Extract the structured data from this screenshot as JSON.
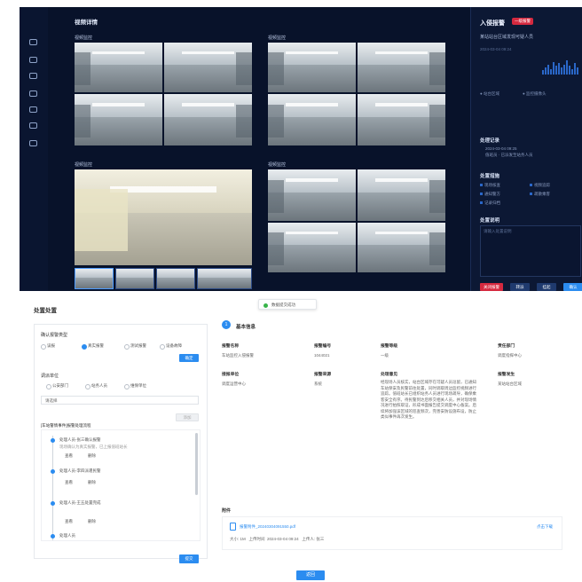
{
  "video_panel": {
    "title": "视频详情",
    "group_labels": [
      "视频监控",
      "视频监控",
      "视频监控",
      "视频监控"
    ]
  },
  "alarm": {
    "title": "入侵报警",
    "badge": "一级报警",
    "subtitle": "某站站台区域发现可疑人员",
    "date": "2024-03-04 09:24",
    "meta_left": "● 站台区域",
    "meta_right": "● 监控摄像头",
    "bar_levels": [
      0.3,
      0.5,
      0.7,
      0.4,
      0.9,
      0.6,
      0.8,
      0.5,
      0.7,
      1.0,
      0.6,
      0.4,
      0.8,
      0.5
    ],
    "section_handle": "处理记录",
    "handle_lines": [
      "2024-03-04 09:25",
      "值班员 · 已派发至站务人员"
    ],
    "section_chips": "处置措施",
    "chips": [
      "现场核查",
      "视频追踪",
      "通知警方",
      "疏散乘客",
      "记录归档"
    ],
    "section_note": "处置说明",
    "note_placeholder": "请输入处置说明",
    "buttons": [
      "关闭报警",
      "转派",
      "挂起",
      "确认"
    ]
  },
  "left_panel": {
    "title": "处置处置",
    "toast": "数据提交成功",
    "level_label": "确认报警类型",
    "level_options": [
      "误报",
      "真实报警",
      "测试报警",
      "设备故障"
    ],
    "level_selected_index": 1,
    "confirm_label": "确定",
    "dispatch_label": "调派单位",
    "dispatch_options": [
      "公安部门",
      "站务人员",
      "维保单位"
    ],
    "select_value": "请选择",
    "add_label": "添加",
    "timeline_title": "[车站警情事件]报警处理流程",
    "timeline": [
      {
        "title": "处理人员-张三确认报警",
        "note": "现场确认为真实报警，已上报值班站长"
      },
      {
        "title": "处理人员-李四派遣民警",
        "note": ""
      },
      {
        "title": "处理人员-王五处置完成",
        "note": ""
      },
      {
        "title": "处理人员",
        "note": ""
      }
    ],
    "timeline_actions": [
      "查看",
      "删除"
    ],
    "submit_label": "提交"
  },
  "detail": {
    "section_no": "1",
    "section_title": "基本信息",
    "fields": [
      {
        "k": "报警名称",
        "v": "车站监控入侵报警"
      },
      {
        "k": "报警编号",
        "v": "1044021"
      },
      {
        "k": "报警等级",
        "v": "一级"
      },
      {
        "k": "责任部门",
        "v": "调度指挥中心"
      },
      {
        "k": "接报单位",
        "v": "调度运营中心"
      },
      {
        "k": "报警来源",
        "v": "系统"
      },
      {
        "k": "处理意见",
        "v": ""
      },
      {
        "k": "报警发生",
        "v": "某站站台区域"
      }
    ],
    "opinion_text": "经现场人员核实，站台区域存在可疑人员逗留，已通知车站保安及民警前往处置，同时调取周边监控视频进行追踪。值班站长已组织站务人员进行现场疏导，确保乘客安全有序。待民警到达后移交相关人员，并对现场情况进行拍照取证，形成书面报告提交调度中心备案。后续将加强该区域的巡查频次，完善安防设施布设，防止类似事件再次发生。",
    "attachment_title": "附件",
    "file_name": "报警附件_20240304091550.pdf",
    "file_size": "大小: 1M",
    "uploader_label": "上传时间",
    "upload_time": "2024-03-04 09:24",
    "upload_by": "上传人: 张三",
    "download": "点击下载",
    "footer_button": "返回"
  }
}
